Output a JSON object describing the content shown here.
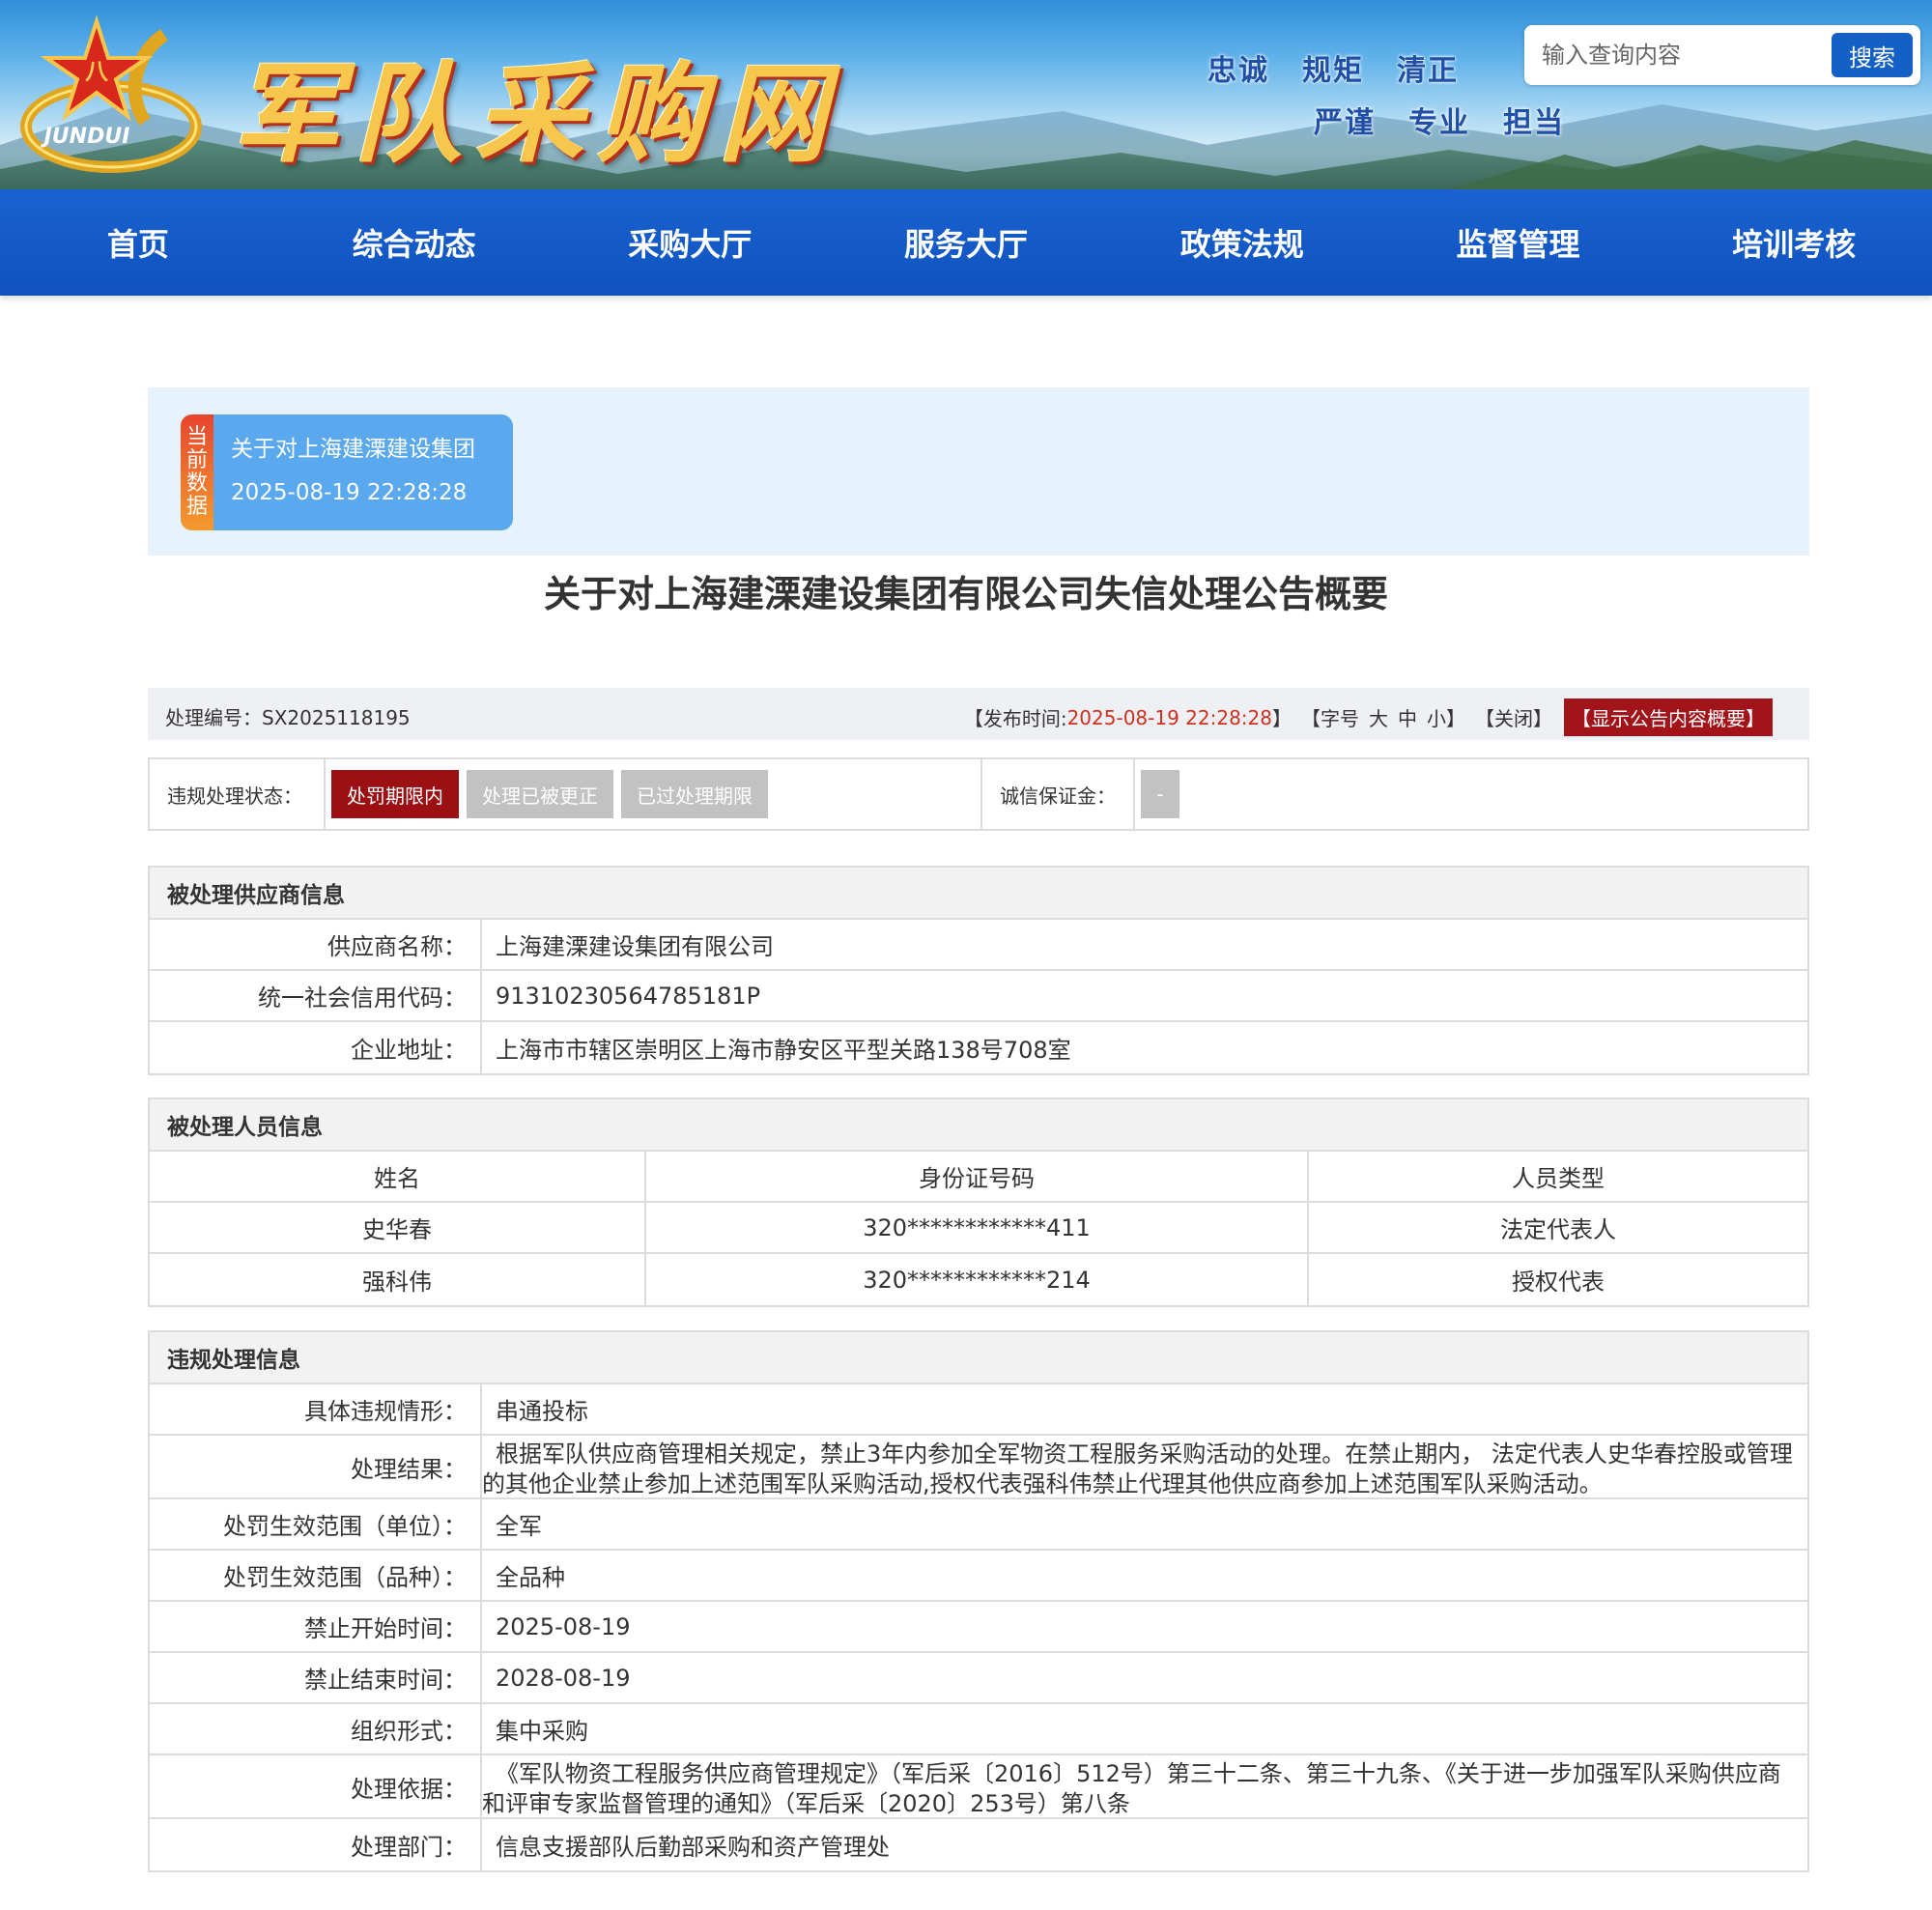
{
  "header": {
    "site_title": "军队采购网",
    "logo_text": "JUNDUI",
    "motto_row1": [
      "忠诚",
      "规矩",
      "清正"
    ],
    "motto_row2": [
      "严谨",
      "专业",
      "担当"
    ],
    "search": {
      "placeholder": "输入查询内容",
      "button_label": "搜索"
    }
  },
  "nav": {
    "items": [
      "首页",
      "综合动态",
      "采购大厅",
      "服务大厅",
      "政策法规",
      "监督管理",
      "培训考核"
    ]
  },
  "current": {
    "tag": "当前数据",
    "title": "关于对上海建溧建设集团",
    "datetime": "2025-08-19 22:28:28"
  },
  "page_title": "关于对上海建溧建设集团有限公司失信处理公告概要",
  "meta": {
    "case_no_label": "处理编号：",
    "case_no": "SX2025118195",
    "publish_label": "【发布时间: ",
    "publish_time": "2025-08-19 22:28:28",
    "publish_close": "】",
    "font_label_open": "【字号",
    "font_large": "大",
    "font_medium": "中",
    "font_small": "小】",
    "close_label": "【关闭】",
    "summary_button": "【显示公告内容概要】"
  },
  "status": {
    "label": "违规处理状态：",
    "badges": [
      {
        "label": "处罚期限内",
        "active": true
      },
      {
        "label": "处理已被更正",
        "active": false
      },
      {
        "label": "已过处理期限",
        "active": false
      }
    ],
    "deposit_label": "诚信保证金：",
    "deposit_value": "-"
  },
  "supplier": {
    "section_title": "被处理供应商信息",
    "rows": [
      {
        "label": "供应商名称：",
        "value": "上海建溧建设集团有限公司"
      },
      {
        "label": "统一社会信用代码：",
        "value": "91310230564785181P"
      },
      {
        "label": "企业地址：",
        "value": "上海市市辖区崇明区上海市静安区平型关路138号708室"
      }
    ]
  },
  "persons": {
    "section_title": "被处理人员信息",
    "headers": [
      "姓名",
      "身份证号码",
      "人员类型"
    ],
    "rows": [
      [
        "史华春",
        "320************411",
        "法定代表人"
      ],
      [
        "强科伟",
        "320************214",
        "授权代表"
      ]
    ]
  },
  "violation": {
    "section_title": "违规处理信息",
    "rows": [
      {
        "label": "具体违规情形：",
        "value": "串通投标"
      },
      {
        "label": "处理结果：",
        "value": "根据军队供应商管理相关规定，禁止3年内参加全军物资工程服务采购活动的处理。在禁止期内， 法定代表人史华春控股或管理的其他企业禁止参加上述范围军队采购活动,授权代表强科伟禁止代理其他供应商参加上述范围军队采购活动。"
      },
      {
        "label": "处罚生效范围（单位）：",
        "value": "全军"
      },
      {
        "label": "处罚生效范围（品种）：",
        "value": "全品种"
      },
      {
        "label": "禁止开始时间：",
        "value": "2025-08-19"
      },
      {
        "label": "禁止结束时间：",
        "value": "2028-08-19"
      },
      {
        "label": "组织形式：",
        "value": "集中采购"
      },
      {
        "label": "处理依据：",
        "value": "《军队物资工程服务供应商管理规定》（军后采〔2016〕512号）第三十二条、第三十九条、《关于进一步加强军队采购供应商和评审专家监督管理的通知》（军后采〔2020〕253号）第八条"
      },
      {
        "label": "处理部门：",
        "value": "信息支援部队后勤部采购和资产管理处"
      }
    ]
  },
  "colors": {
    "nav_blue": "#1560c5",
    "active_red": "#9c0f13",
    "inactive_gray": "#c2c2c2",
    "publish_time_red": "#d0301e"
  }
}
